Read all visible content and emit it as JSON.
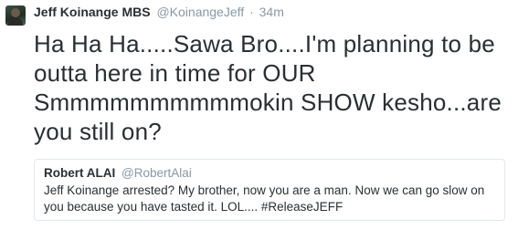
{
  "tweet": {
    "author_name": "Jeff Koinange MBS",
    "author_handle": "@KoinangeJeff",
    "separator": "·",
    "time": "34m",
    "text": "Ha Ha Ha.....Sawa Bro....I'm planning to be outta here in time for OUR Smmmmmmmmmmokin SHOW kesho...are you still on?"
  },
  "quoted_tweet": {
    "author_name": "Robert ALAI",
    "author_handle": "@RobertAlai",
    "text": "Jeff Koinange arrested? My brother, now you are a man. Now we can go slow on you because you have tasted it. LOL.... #ReleaseJEFF"
  },
  "colors": {
    "text": "#292f33",
    "muted": "#8899a6",
    "border": "#e1e8ed"
  }
}
